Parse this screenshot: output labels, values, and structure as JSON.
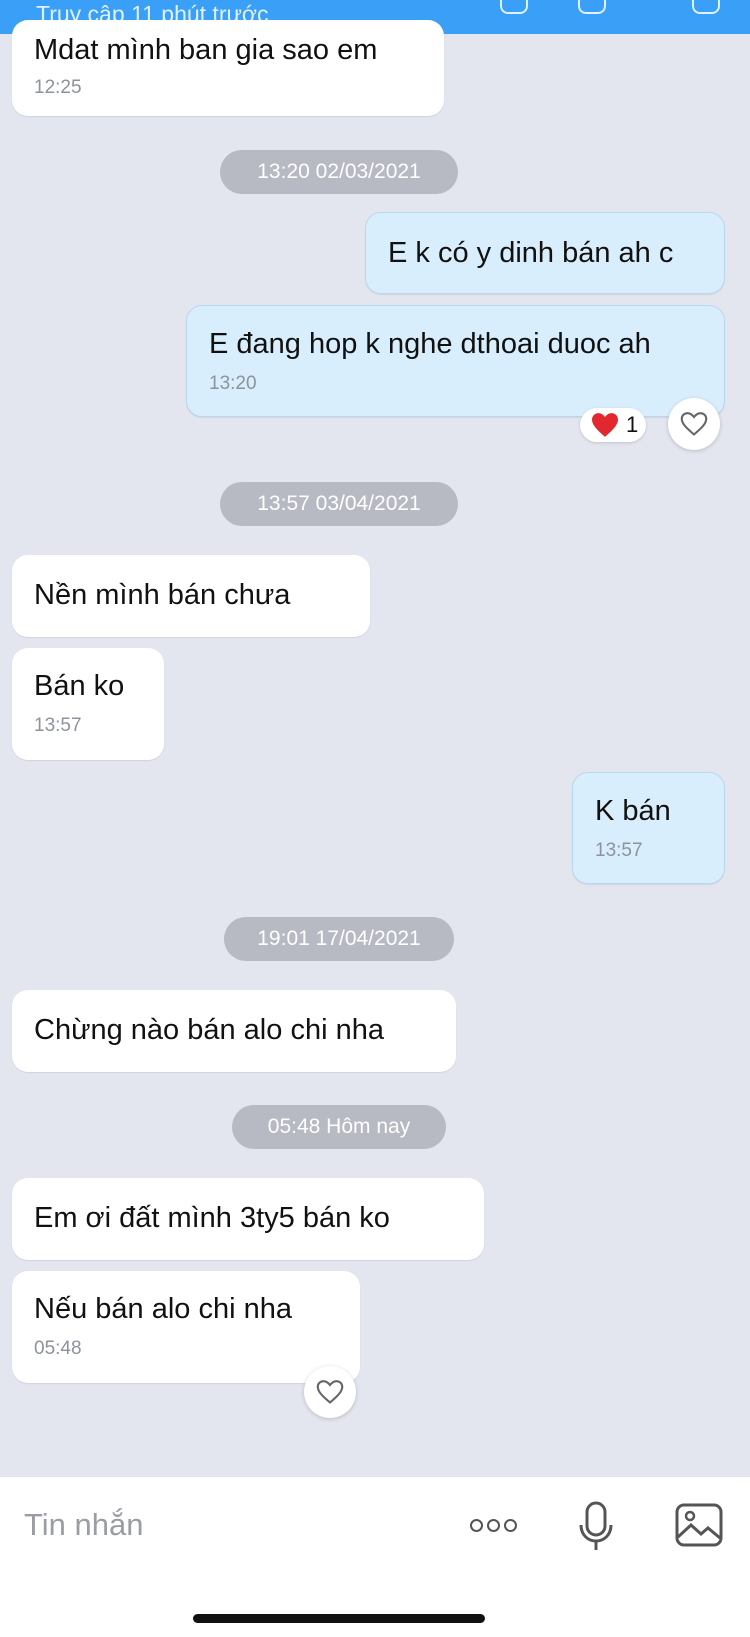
{
  "header": {
    "status": "Truy cập 11 phút trước"
  },
  "date_separators": {
    "d1": "13:20 02/03/2021",
    "d2": "13:57 03/04/2021",
    "d3": "19:01 17/04/2021",
    "d4": "05:48 Hôm nay"
  },
  "messages": {
    "m1": {
      "text": "Mdat mình  ban gia sao em",
      "time": "12:25"
    },
    "m2": {
      "text": "E k có y dinh bán ah c"
    },
    "m3": {
      "text": "E đang hop k nghe dthoai duoc ah",
      "time": "13:20",
      "reaction": {
        "emoji": "heart",
        "count": "1"
      }
    },
    "m4": {
      "text": "Nền  mình  bán  chưa"
    },
    "m5": {
      "text": "Bán  ko",
      "time": "13:57"
    },
    "m6": {
      "text": "K bán",
      "time": "13:57"
    },
    "m7": {
      "text": "Chừng nào  bán  alo chi nha"
    },
    "m8": {
      "text": "Em ơi  đất  mình  3ty5 bán  ko"
    },
    "m9": {
      "text": "Nếu  bán  alo chi nha",
      "time": "05:48"
    }
  },
  "composer": {
    "placeholder": "Tin nhắn",
    "icons": [
      "more-icon",
      "microphone-icon",
      "image-icon"
    ]
  },
  "colors": {
    "background": "#e3e5ef",
    "outgoing_bubble": "#d8eefd",
    "incoming_bubble": "#ffffff",
    "header": "#3aa0f7",
    "reaction_heart": "#e0282e"
  }
}
